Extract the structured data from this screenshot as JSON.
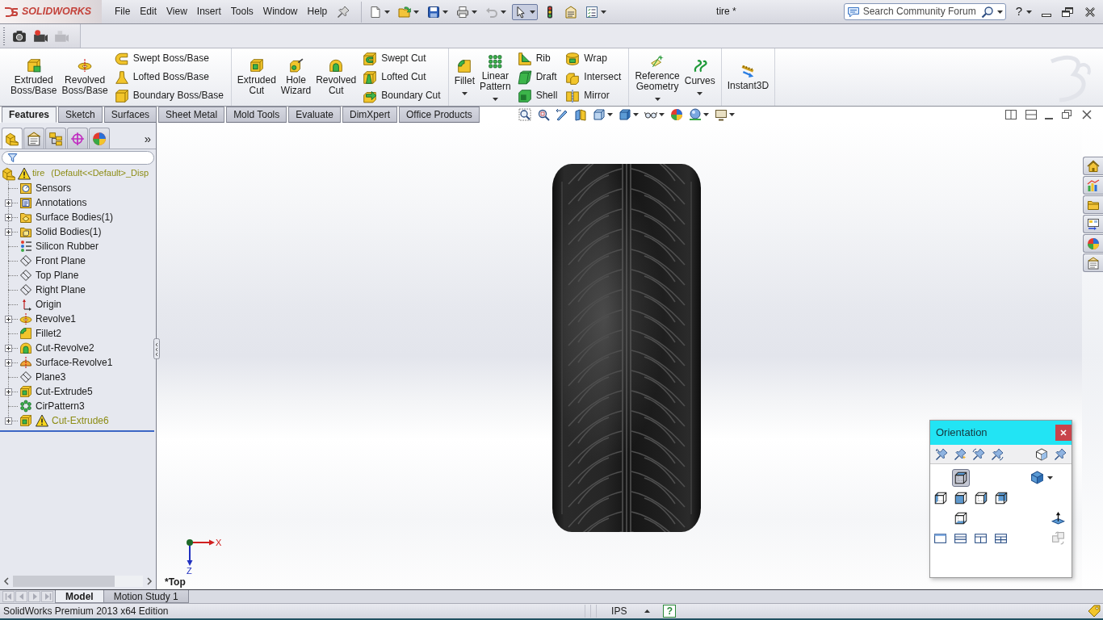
{
  "title_bar": {
    "logo": "SOLIDWORKS",
    "menu": [
      "File",
      "Edit",
      "View",
      "Insert",
      "Tools",
      "Window",
      "Help"
    ],
    "quick_access": [
      {
        "kind": "new",
        "dropdown": true,
        "pressed": false,
        "disabled": false
      },
      {
        "kind": "open",
        "dropdown": true,
        "pressed": false,
        "disabled": false
      },
      {
        "kind": "save",
        "dropdown": true,
        "pressed": false,
        "disabled": false
      },
      {
        "kind": "print",
        "dropdown": true,
        "pressed": false,
        "disabled": false
      },
      {
        "kind": "undo",
        "dropdown": true,
        "pressed": false,
        "disabled": true
      },
      {
        "kind": "select",
        "dropdown": true,
        "pressed": true,
        "disabled": false
      },
      {
        "kind": "rebuild",
        "dropdown": false,
        "pressed": false,
        "disabled": false
      },
      {
        "kind": "file_properties",
        "dropdown": false,
        "pressed": false,
        "disabled": false
      },
      {
        "kind": "options",
        "dropdown": true,
        "pressed": false,
        "disabled": false
      }
    ],
    "document_title": "tire *",
    "search": {
      "placeholder": "Search Community Forum"
    },
    "help": "?"
  },
  "command_manager": {
    "groups": [
      {
        "items": [
          {
            "label": "Extruded\nBoss/Base",
            "kind": "extrude",
            "large": true,
            "dropdown": false
          },
          {
            "label": "Revolved\nBoss/Base",
            "kind": "revolve",
            "large": true,
            "dropdown": false
          },
          {
            "label": "Swept Boss/Base",
            "kind": "swept",
            "large": false,
            "dropdown": false
          },
          {
            "label": "Lofted Boss/Base",
            "kind": "loft",
            "large": false,
            "dropdown": false
          },
          {
            "label": "Boundary Boss/Base",
            "kind": "boundary",
            "large": false,
            "dropdown": false
          }
        ]
      },
      {
        "items": [
          {
            "label": "Extruded\nCut",
            "kind": "extrude_cut",
            "large": true,
            "dropdown": false
          },
          {
            "label": "Hole\nWizard",
            "kind": "hole",
            "large": true,
            "dropdown": false
          },
          {
            "label": "Revolved\nCut",
            "kind": "revolve_cut",
            "large": true,
            "dropdown": false
          },
          {
            "label": "Swept Cut",
            "kind": "swept_cut",
            "large": false,
            "dropdown": false
          },
          {
            "label": "Lofted Cut",
            "kind": "loft_cut",
            "large": false,
            "dropdown": false
          },
          {
            "label": "Boundary Cut",
            "kind": "boundary_cut",
            "large": false,
            "dropdown": false
          }
        ]
      },
      {
        "items": [
          {
            "label": "Fillet",
            "kind": "fillet",
            "large": true,
            "dropdown": true
          },
          {
            "label": "Linear\nPattern",
            "kind": "linear_pattern",
            "large": true,
            "dropdown": true
          },
          {
            "label": "Rib",
            "kind": "rib",
            "large": false,
            "dropdown": false
          },
          {
            "label": "Draft",
            "kind": "draft",
            "large": false,
            "dropdown": false
          },
          {
            "label": "Shell",
            "kind": "shell",
            "large": false,
            "dropdown": false
          },
          {
            "label": "Wrap",
            "kind": "wrap",
            "large": false,
            "dropdown": false
          },
          {
            "label": "Intersect",
            "kind": "intersect",
            "large": false,
            "dropdown": false
          },
          {
            "label": "Mirror",
            "kind": "mirror",
            "large": false,
            "dropdown": false
          }
        ]
      },
      {
        "items": [
          {
            "label": "Reference\nGeometry",
            "kind": "ref_geometry",
            "large": true,
            "dropdown": true
          },
          {
            "label": "Curves",
            "kind": "curves",
            "large": true,
            "dropdown": true
          }
        ]
      },
      {
        "items": [
          {
            "label": "Instant3D",
            "kind": "instant3d",
            "large": true,
            "dropdown": false
          }
        ]
      }
    ],
    "tabs": [
      {
        "label": "Features",
        "selected": true
      },
      {
        "label": "Sketch",
        "selected": false
      },
      {
        "label": "Surfaces",
        "selected": false
      },
      {
        "label": "Sheet Metal",
        "selected": false
      },
      {
        "label": "Mold Tools",
        "selected": false
      },
      {
        "label": "Evaluate",
        "selected": false
      },
      {
        "label": "DimXpert",
        "selected": false
      },
      {
        "label": "Office Products",
        "selected": false
      }
    ]
  },
  "feature_manager": {
    "tabs": [
      {
        "kind": "feature_manager",
        "selected": true
      },
      {
        "kind": "property_manager",
        "selected": false
      },
      {
        "kind": "configuration_manager",
        "selected": false
      },
      {
        "kind": "dimxpert_manager",
        "selected": false
      },
      {
        "kind": "display_manager",
        "selected": false
      }
    ],
    "more": "»",
    "tree": {
      "name": "tire",
      "config": "(Default<<Default>_Disp",
      "warning": true,
      "children": [
        {
          "name": "Sensors",
          "kind": "sensors",
          "expandable": false,
          "warning": false
        },
        {
          "name": "Annotations",
          "kind": "annotations",
          "expandable": true,
          "warning": false
        },
        {
          "name": "Surface Bodies(1)",
          "kind": "surface_bodies",
          "expandable": true,
          "warning": false
        },
        {
          "name": "Solid Bodies(1)",
          "kind": "solid_bodies",
          "expandable": true,
          "warning": false
        },
        {
          "name": "Silicon Rubber",
          "kind": "material",
          "expandable": false,
          "warning": false
        },
        {
          "name": "Front Plane",
          "kind": "plane",
          "expandable": false,
          "warning": false
        },
        {
          "name": "Top Plane",
          "kind": "plane",
          "expandable": false,
          "warning": false
        },
        {
          "name": "Right Plane",
          "kind": "plane",
          "expandable": false,
          "warning": false
        },
        {
          "name": "Origin",
          "kind": "origin",
          "expandable": false,
          "warning": false
        },
        {
          "name": "Revolve1",
          "kind": "revolve",
          "expandable": true,
          "warning": false
        },
        {
          "name": "Fillet2",
          "kind": "fillet",
          "expandable": false,
          "warning": false
        },
        {
          "name": "Cut-Revolve2",
          "kind": "cut_revolve",
          "expandable": true,
          "warning": false
        },
        {
          "name": "Surface-Revolve1",
          "kind": "surface_revolve",
          "expandable": true,
          "warning": false
        },
        {
          "name": "Plane3",
          "kind": "plane",
          "expandable": false,
          "warning": false
        },
        {
          "name": "Cut-Extrude5",
          "kind": "cut_extrude",
          "expandable": true,
          "warning": false
        },
        {
          "name": "CirPattern3",
          "kind": "pattern",
          "expandable": false,
          "warning": false
        },
        {
          "name": "Cut-Extrude6",
          "kind": "cut_extrude",
          "expandable": true,
          "warning": true
        }
      ]
    }
  },
  "graphics_area": {
    "view_name": "*Top",
    "triad": {
      "x_label": "X",
      "z_label": "Z"
    },
    "orientation": {
      "title": "Orientation",
      "views": [
        {
          "kind": "top",
          "selected": true
        },
        {
          "kind": "left",
          "selected": false
        },
        {
          "kind": "front",
          "selected": false
        },
        {
          "kind": "right",
          "selected": false
        },
        {
          "kind": "back",
          "selected": false
        },
        {
          "kind": "bottom",
          "selected": false
        }
      ]
    }
  },
  "bottom_tabs": [
    {
      "label": "Model",
      "selected": true
    },
    {
      "label": "Motion Study 1",
      "selected": false
    }
  ],
  "status_bar": {
    "product": "SolidWorks Premium 2013 x64 Edition",
    "units": "IPS",
    "help": "?"
  }
}
